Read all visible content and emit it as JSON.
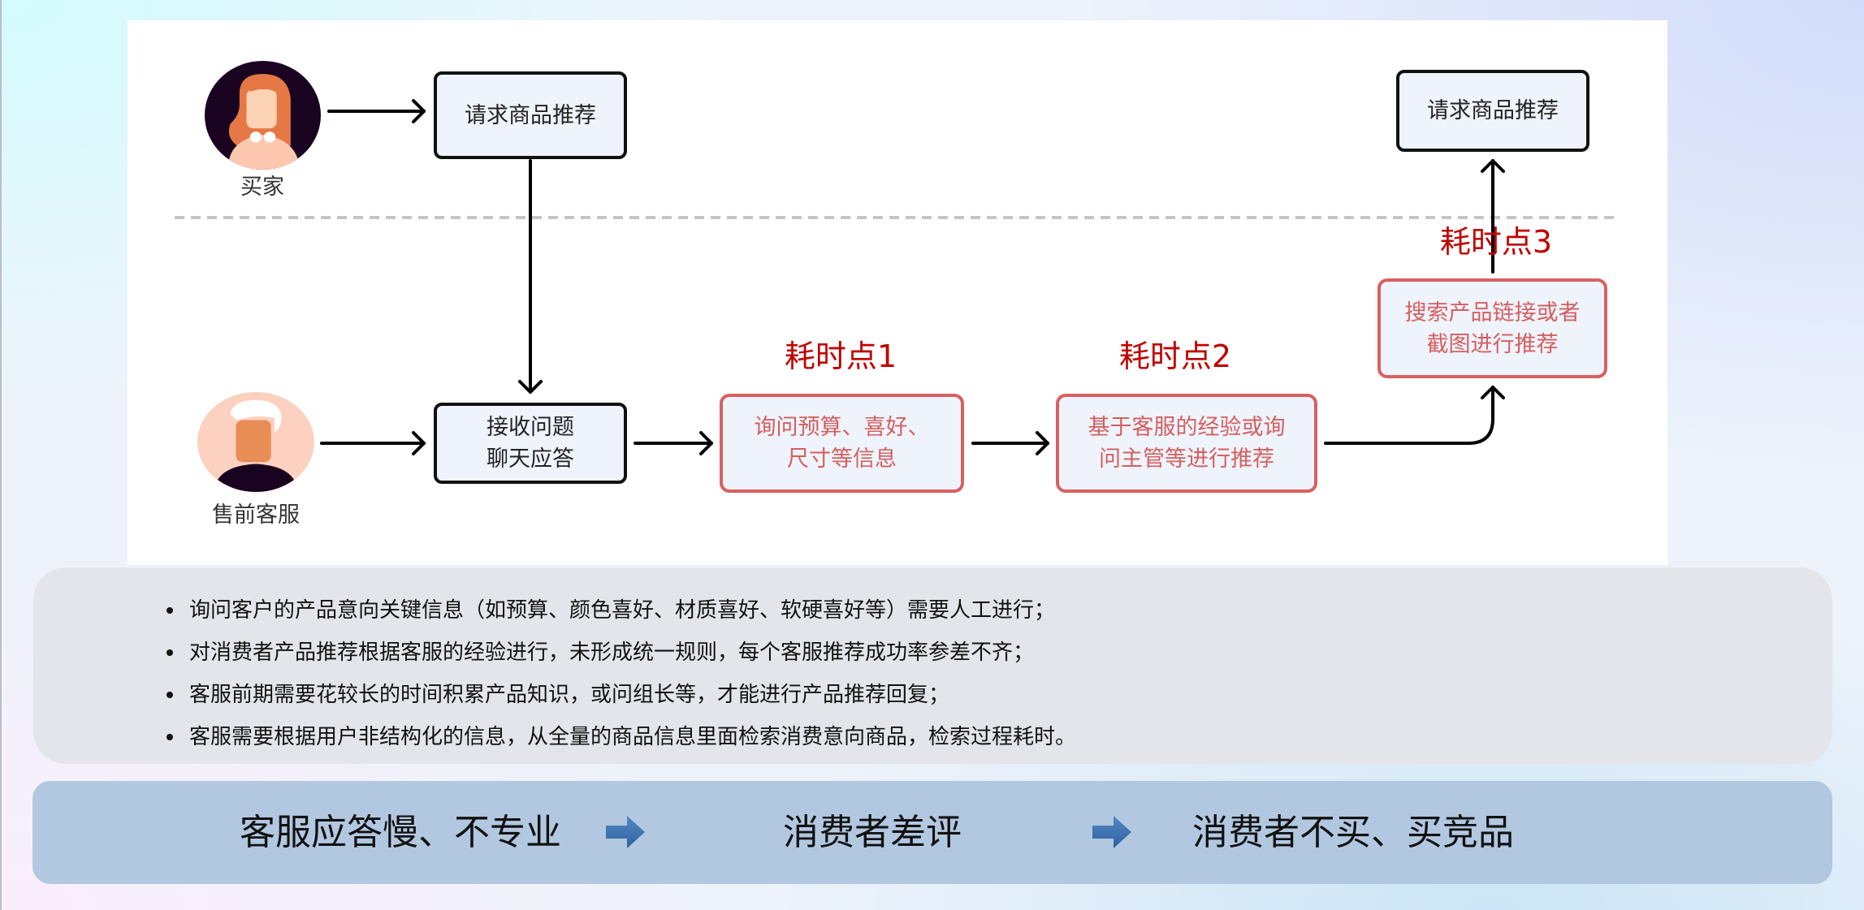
{
  "actors": {
    "buyer": {
      "label": "买家",
      "icon": "female-user-avatar"
    },
    "agent": {
      "label": "售前客服",
      "icon": "male-user-avatar"
    }
  },
  "flow": {
    "buyer_request": "请求商品推荐",
    "receive": {
      "line1": "接收问题",
      "line2": "聊天应答"
    },
    "step1": {
      "line1": "询问预算、喜好、",
      "line2": "尺寸等信息"
    },
    "step2": {
      "line1": "基于客服的经验或询",
      "line2": "问主管等进行推荐"
    },
    "step3": {
      "line1": "搜索产品链接或者",
      "line2": "截图进行推荐"
    },
    "buyer_result": "请求商品推荐"
  },
  "hotspots": [
    "耗时点1",
    "耗时点2",
    "耗时点3"
  ],
  "notes": [
    "询问客户的产品意向关键信息（如预算、颜色喜好、材质喜好、软硬喜好等）需要人工进行；",
    "对消费者产品推荐根据客服的经验进行，未形成统一规则，每个客服推荐成功率参差不齐；",
    "客服前期需要花较长的时间积累产品知识，或问组长等，才能进行产品推荐回复；",
    "客服需要根据用户非结构化的信息，从全量的商品信息里面检索消费意向商品，检索过程耗时。"
  ],
  "impact_chain": [
    "客服应答慢、不专业",
    "消费者差评",
    "消费者不买、买竞品"
  ],
  "colors": {
    "hotspot_text": "#c00000",
    "problem_box_border": "#d66161",
    "node_fill": "#eff3fb",
    "notes_panel": "#e4e5ea",
    "impact_bar": "#b2c8e0",
    "impact_arrow": "#3d73b0"
  }
}
